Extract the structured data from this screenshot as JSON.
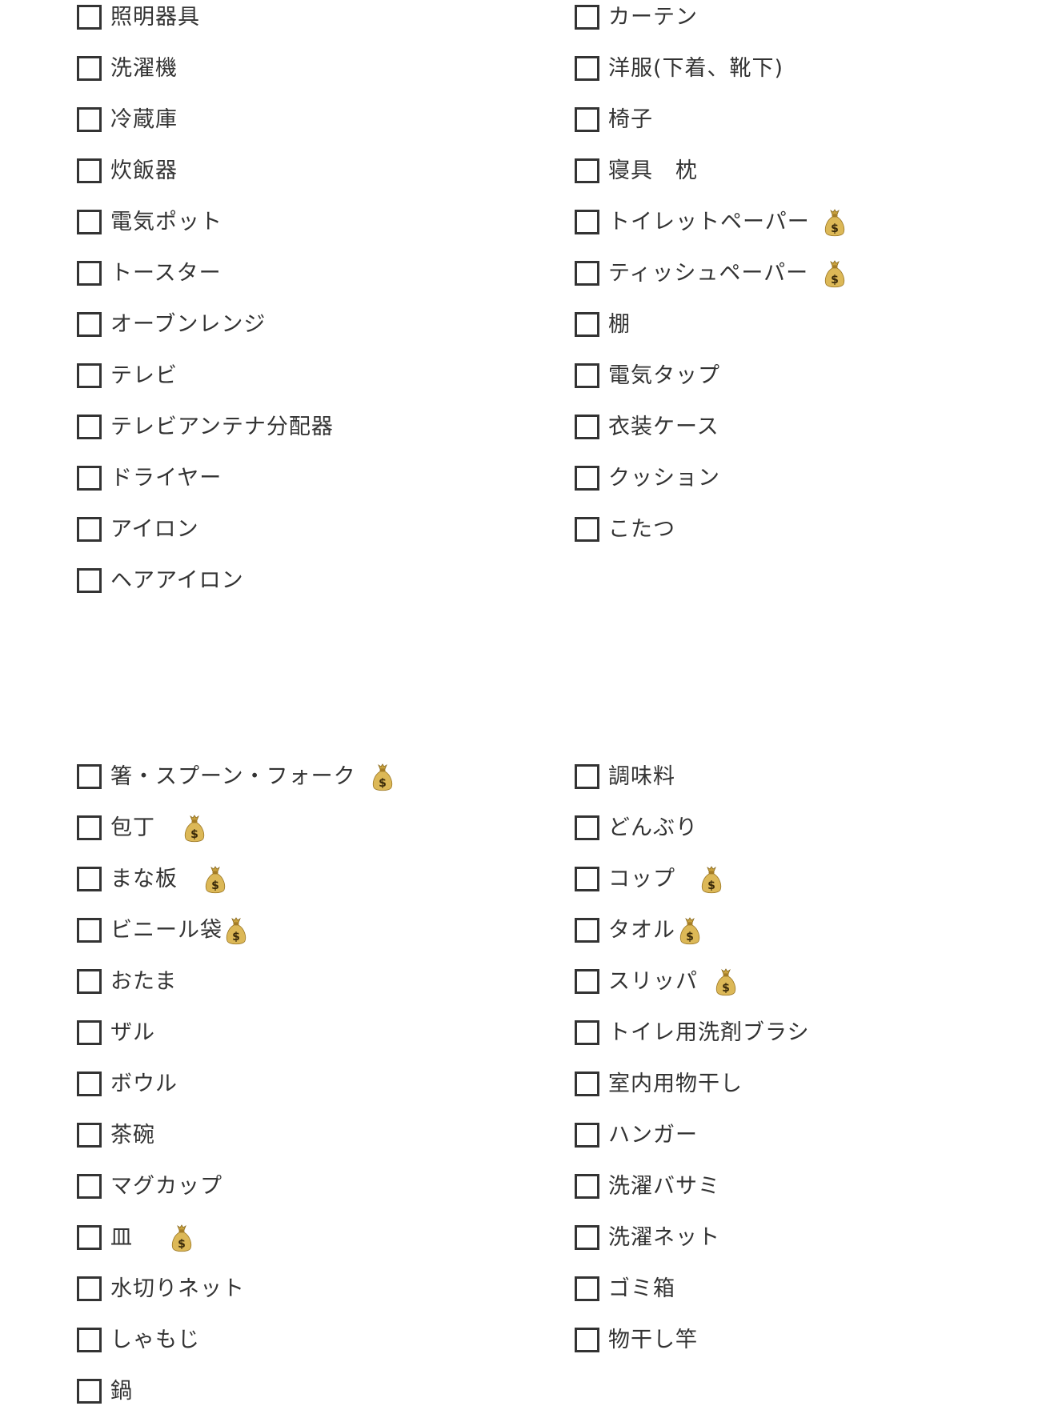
{
  "icons": {
    "checkbox": "empty-checkbox",
    "money": "money-bag-icon"
  },
  "colors": {
    "text": "#333333",
    "checkbox_border": "#333333",
    "money_bag": "#d9b24c"
  },
  "sections": [
    {
      "columns": [
        {
          "items": [
            {
              "label": "照明器具",
              "money": false,
              "checked": false
            },
            {
              "label": "洗濯機",
              "money": false,
              "checked": false
            },
            {
              "label": "冷蔵庫",
              "money": false,
              "checked": false
            },
            {
              "label": "炊飯器",
              "money": false,
              "checked": false
            },
            {
              "label": "電気ポット",
              "money": false,
              "checked": false
            },
            {
              "label": "トースター",
              "money": false,
              "checked": false
            },
            {
              "label": "オーブンレンジ",
              "money": false,
              "checked": false
            },
            {
              "label": "テレビ",
              "money": false,
              "checked": false
            },
            {
              "label": "テレビアンテナ分配器",
              "money": false,
              "checked": false
            },
            {
              "label": "ドライヤー",
              "money": false,
              "checked": false
            },
            {
              "label": "アイロン",
              "money": false,
              "checked": false
            },
            {
              "label": "ヘアアイロン",
              "money": false,
              "checked": false
            }
          ]
        },
        {
          "items": [
            {
              "label": "カーテン",
              "money": false,
              "checked": false
            },
            {
              "label": "洋服(下着、靴下)",
              "money": false,
              "checked": false
            },
            {
              "label": "椅子",
              "money": false,
              "checked": false
            },
            {
              "label": "寝具　枕",
              "money": false,
              "checked": false
            },
            {
              "label": "トイレットペーパー",
              "money": true,
              "checked": false
            },
            {
              "label": "ティッシュペーパー",
              "money": true,
              "checked": false
            },
            {
              "label": "棚",
              "money": false,
              "checked": false
            },
            {
              "label": "電気タップ",
              "money": false,
              "checked": false
            },
            {
              "label": "衣装ケース",
              "money": false,
              "checked": false
            },
            {
              "label": "クッション",
              "money": false,
              "checked": false
            },
            {
              "label": "こたつ",
              "money": false,
              "checked": false
            }
          ]
        }
      ]
    },
    {
      "columns": [
        {
          "items": [
            {
              "label": "箸・スプーン・フォーク",
              "money": true,
              "checked": false
            },
            {
              "label": "包丁",
              "money": true,
              "checked": false
            },
            {
              "label": "まな板",
              "money": true,
              "checked": false
            },
            {
              "label": "ビニール袋",
              "money": true,
              "checked": false
            },
            {
              "label": "おたま",
              "money": false,
              "checked": false
            },
            {
              "label": "ザル",
              "money": false,
              "checked": false
            },
            {
              "label": "ボウル",
              "money": false,
              "checked": false
            },
            {
              "label": "茶碗",
              "money": false,
              "checked": false
            },
            {
              "label": "マグカップ",
              "money": false,
              "checked": false
            },
            {
              "label": "皿",
              "money": true,
              "checked": false
            },
            {
              "label": "水切りネット",
              "money": false,
              "checked": false
            },
            {
              "label": "しゃもじ",
              "money": false,
              "checked": false
            },
            {
              "label": "鍋",
              "money": false,
              "checked": false
            }
          ]
        },
        {
          "items": [
            {
              "label": "調味料",
              "money": false,
              "checked": false
            },
            {
              "label": "どんぶり",
              "money": false,
              "checked": false
            },
            {
              "label": "コップ",
              "money": true,
              "checked": false
            },
            {
              "label": "タオル",
              "money": true,
              "checked": false
            },
            {
              "label": "スリッパ",
              "money": true,
              "checked": false
            },
            {
              "label": "トイレ用洗剤ブラシ",
              "money": false,
              "checked": false
            },
            {
              "label": "室内用物干し",
              "money": false,
              "checked": false
            },
            {
              "label": "ハンガー",
              "money": false,
              "checked": false
            },
            {
              "label": "洗濯バサミ",
              "money": false,
              "checked": false
            },
            {
              "label": "洗濯ネット",
              "money": false,
              "checked": false
            },
            {
              "label": "ゴミ箱",
              "money": false,
              "checked": false
            },
            {
              "label": "物干し竿",
              "money": false,
              "checked": false
            }
          ]
        }
      ]
    }
  ]
}
